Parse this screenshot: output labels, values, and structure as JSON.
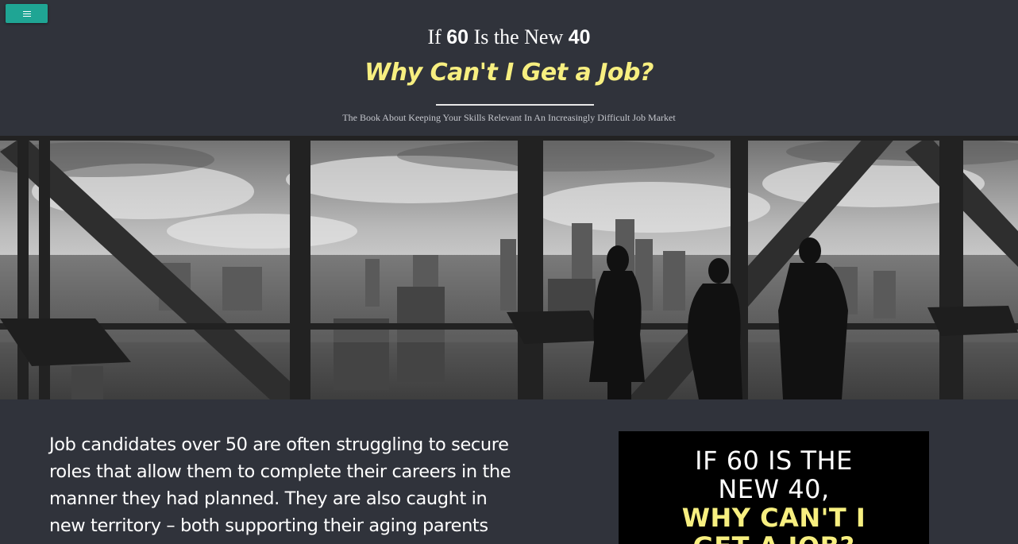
{
  "menu": {
    "icon": "hamburger-icon",
    "accent": "#1fa594"
  },
  "header": {
    "title_if": "If",
    "title_num1": "60",
    "title_mid": "Is the New",
    "title_num2": "40",
    "subtitle": "Why Can't I Get a Job?",
    "tagline": "The Book About Keeping Your Skills Relevant In An Increasingly Difficult Job Market",
    "subtitle_color": "#f7ef80"
  },
  "hero": {
    "image": "office-skyline-silhouettes"
  },
  "intro": {
    "text": "Job candidates over 50 are often struggling to secure roles that allow them to complete their careers in the manner they had planned. They are also caught in new territory – both supporting their aging parents with"
  },
  "book_cover": {
    "line1": "IF 60 IS THE",
    "line2": "NEW 40,",
    "line3": "WHY CAN'T I",
    "line4": "GET A JOB?"
  }
}
